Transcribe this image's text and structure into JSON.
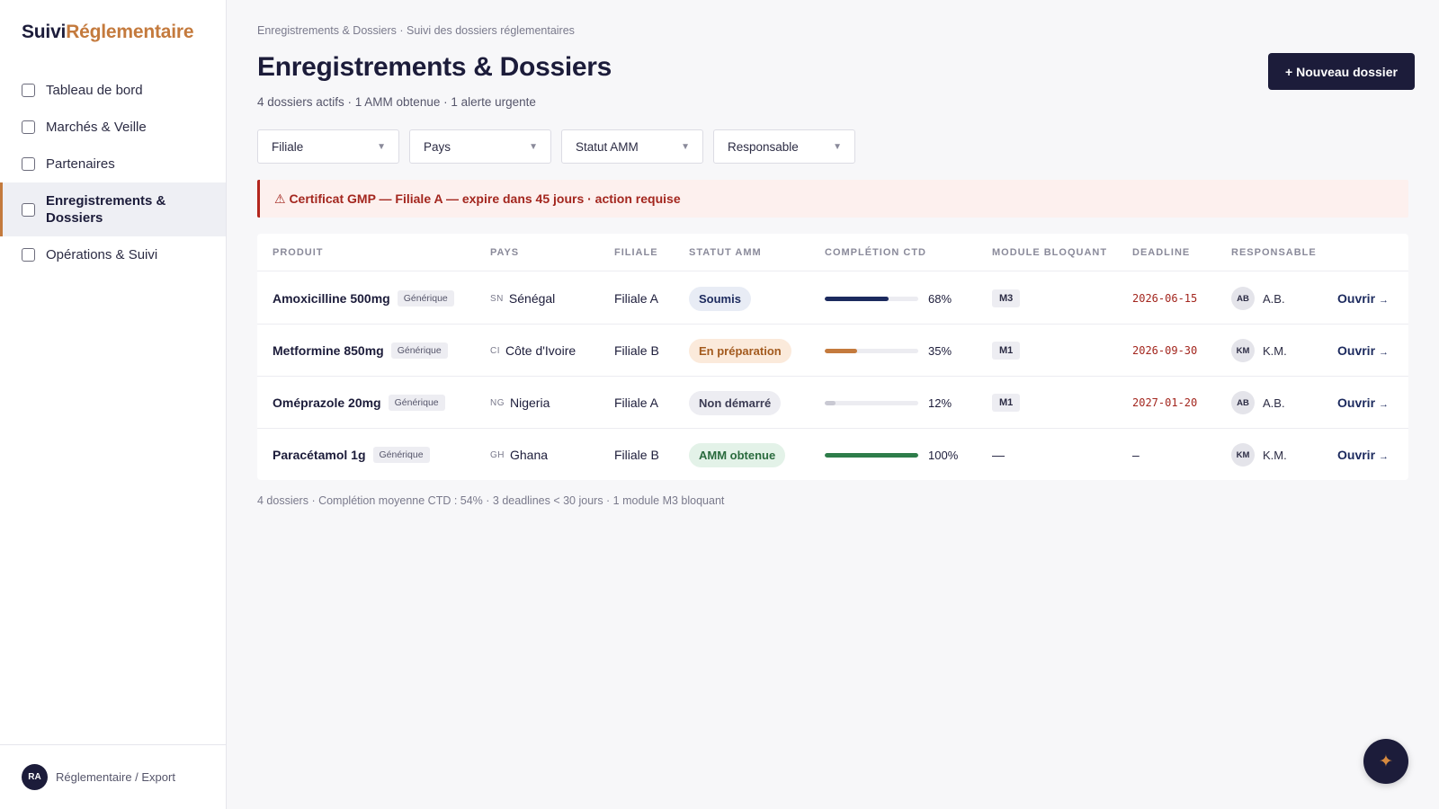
{
  "brand": {
    "part1": "Suivi",
    "part2": "Réglementaire"
  },
  "sidebar": {
    "items": [
      {
        "label": "Tableau de bord"
      },
      {
        "label": "Marchés & Veille"
      },
      {
        "label": "Partenaires"
      },
      {
        "label": "Enregistrements & Dossiers",
        "active": true
      },
      {
        "label": "Opérations & Suivi"
      }
    ],
    "footer": {
      "initials": "RA",
      "label": "Réglementaire / Export"
    }
  },
  "breadcrumb": "Enregistrements & Dossiers · Suivi des dossiers réglementaires",
  "page_title": "Enregistrements & Dossiers",
  "subtitle": "4 dossiers actifs · 1 AMM obtenue · 1 alerte urgente",
  "new_button": "+ Nouveau dossier",
  "filters": [
    "Filiale",
    "Pays",
    "Statut AMM",
    "Responsable"
  ],
  "alert": "⚠ Certificat GMP — Filiale A — expire dans 45 jours · action requise",
  "table": {
    "headers": [
      "Produit",
      "Pays",
      "Filiale",
      "Statut AMM",
      "Complétion CTD",
      "Module bloquant",
      "Deadline",
      "Responsable"
    ],
    "rows": [
      {
        "product": "Amoxicilline 500mg",
        "tag": "Générique",
        "cc": "SN",
        "country": "Sénégal",
        "filiale": "Filiale A",
        "status": "Soumis",
        "progress": 68,
        "pct": "68%",
        "module": "M3",
        "deadline": "2026-06-15",
        "resp_initials": "AB",
        "resp_name": "A.B.",
        "action": "Ouvrir"
      },
      {
        "product": "Metformine 850mg",
        "tag": "Générique",
        "cc": "CI",
        "country": "Côte d'Ivoire",
        "filiale": "Filiale B",
        "status": "En préparation",
        "progress": 35,
        "pct": "35%",
        "module": "M1",
        "deadline": "2026-09-30",
        "resp_initials": "KM",
        "resp_name": "K.M.",
        "action": "Ouvrir"
      },
      {
        "product": "Oméprazole 20mg",
        "tag": "Générique",
        "cc": "NG",
        "country": "Nigeria",
        "filiale": "Filiale A",
        "status": "Non démarré",
        "progress": 12,
        "pct": "12%",
        "module": "M1",
        "deadline": "2027-01-20",
        "resp_initials": "AB",
        "resp_name": "A.B.",
        "action": "Ouvrir"
      },
      {
        "product": "Paracétamol 1g",
        "tag": "Générique",
        "cc": "GH",
        "country": "Ghana",
        "filiale": "Filiale B",
        "status": "AMM obtenue",
        "progress": 100,
        "pct": "100%",
        "module": "—",
        "deadline": "–",
        "resp_initials": "KM",
        "resp_name": "K.M.",
        "action": "Ouvrir"
      }
    ]
  },
  "summary": "4 dossiers · Complétion moyenne CTD : 54% · 3 deadlines < 30 jours · 1 module M3 bloquant",
  "fab_icon": "✦",
  "colors": {
    "accent": "#c47a3d",
    "navy": "#1c1c3a",
    "alert_red": "#a3261e",
    "status_soumis_bg": "#e8ecf5",
    "status_soumis_fg": "#1c2a5e",
    "status_prep_bg": "#fbeadb",
    "status_prep_fg": "#a35a1e",
    "status_nd_bg": "#ededf2",
    "status_nd_fg": "#3c3c54",
    "status_amm_bg": "#e3f2e8",
    "status_amm_fg": "#2a6b3e",
    "bar_soumis": "#1c2a5e",
    "bar_prep": "#c47a3d",
    "bar_nd": "#c9c9d3",
    "bar_amm": "#2e7d4a"
  }
}
